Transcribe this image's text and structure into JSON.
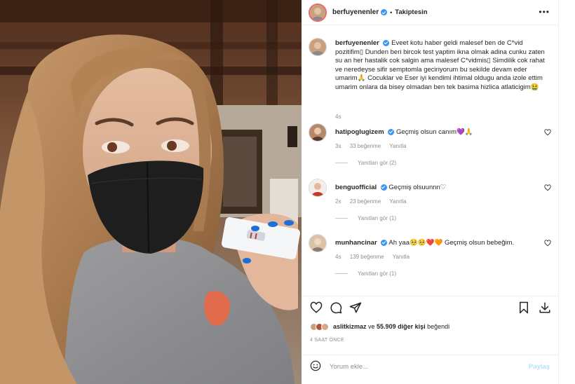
{
  "post": {
    "username": "berfuyenenler",
    "separator": "•",
    "follow_label": "Takiptesin",
    "more_label": "•••"
  },
  "caption": {
    "username": "berfuyenenler",
    "text": "Eveet kotu haber geldi malesef ben de C*vid pozitifim▯ Dunden beri bircok test yaptim ikna olmak adina cunku zaten su an her hastalik cok salgin ama malesef C*vidmis▯ Simdilik cok rahat ve neredeyse sifir semptomla geciriyorum bu sekilde devam eder umarim🙏 Cocuklar ve Eser iyi kendimi ihtimal oldugu anda izole ettim umarim onlara da bisey olmadan ben tek basima hizlica atlaticigim🤮",
    "time": "4s"
  },
  "comments": [
    {
      "username": "hatipoglugizem",
      "text": "Geçmiş olsun canım💜🙏",
      "time": "3s",
      "likes": "33 beğenme",
      "reply": "Yanıtla",
      "view_replies": "Yanıtları gör (2)",
      "avatar_color": "#b58a6b"
    },
    {
      "username": "benguofficial",
      "text": "Geçmiş olsuunnn♡",
      "time": "2s",
      "likes": "23 beğenme",
      "reply": "Yanıtla",
      "view_replies": "Yanıtları gör (1)",
      "avatar_color": "#c0392b"
    },
    {
      "username": "munhancinar",
      "text": "Ah yaa🥺🥺❤️🧡 Geçmiş olsun bebeğim.",
      "time": "4s",
      "likes": "139 beğenme",
      "reply": "Yanıtla",
      "view_replies": "Yanıtları gör (1)",
      "avatar_color": "#d9c2a5"
    }
  ],
  "likes": {
    "user": "aslitkizmaz",
    "connector": " ve ",
    "count_text": "55.909 diğer kişi",
    "suffix": " beğendi"
  },
  "timestamp": "4 SAAT ÖNCE",
  "add_comment": {
    "placeholder": "Yorum ekle...",
    "post_label": "Paylaş"
  },
  "colors": {
    "verified": "#3897f0",
    "post_button_disabled": "#b2dffc",
    "muted_text": "#8e8e8e"
  },
  "icons": [
    "heart-icon",
    "comment-icon",
    "share-icon",
    "bookmark-icon",
    "download-icon",
    "emoji-icon",
    "more-icon",
    "verified-badge-icon"
  ]
}
